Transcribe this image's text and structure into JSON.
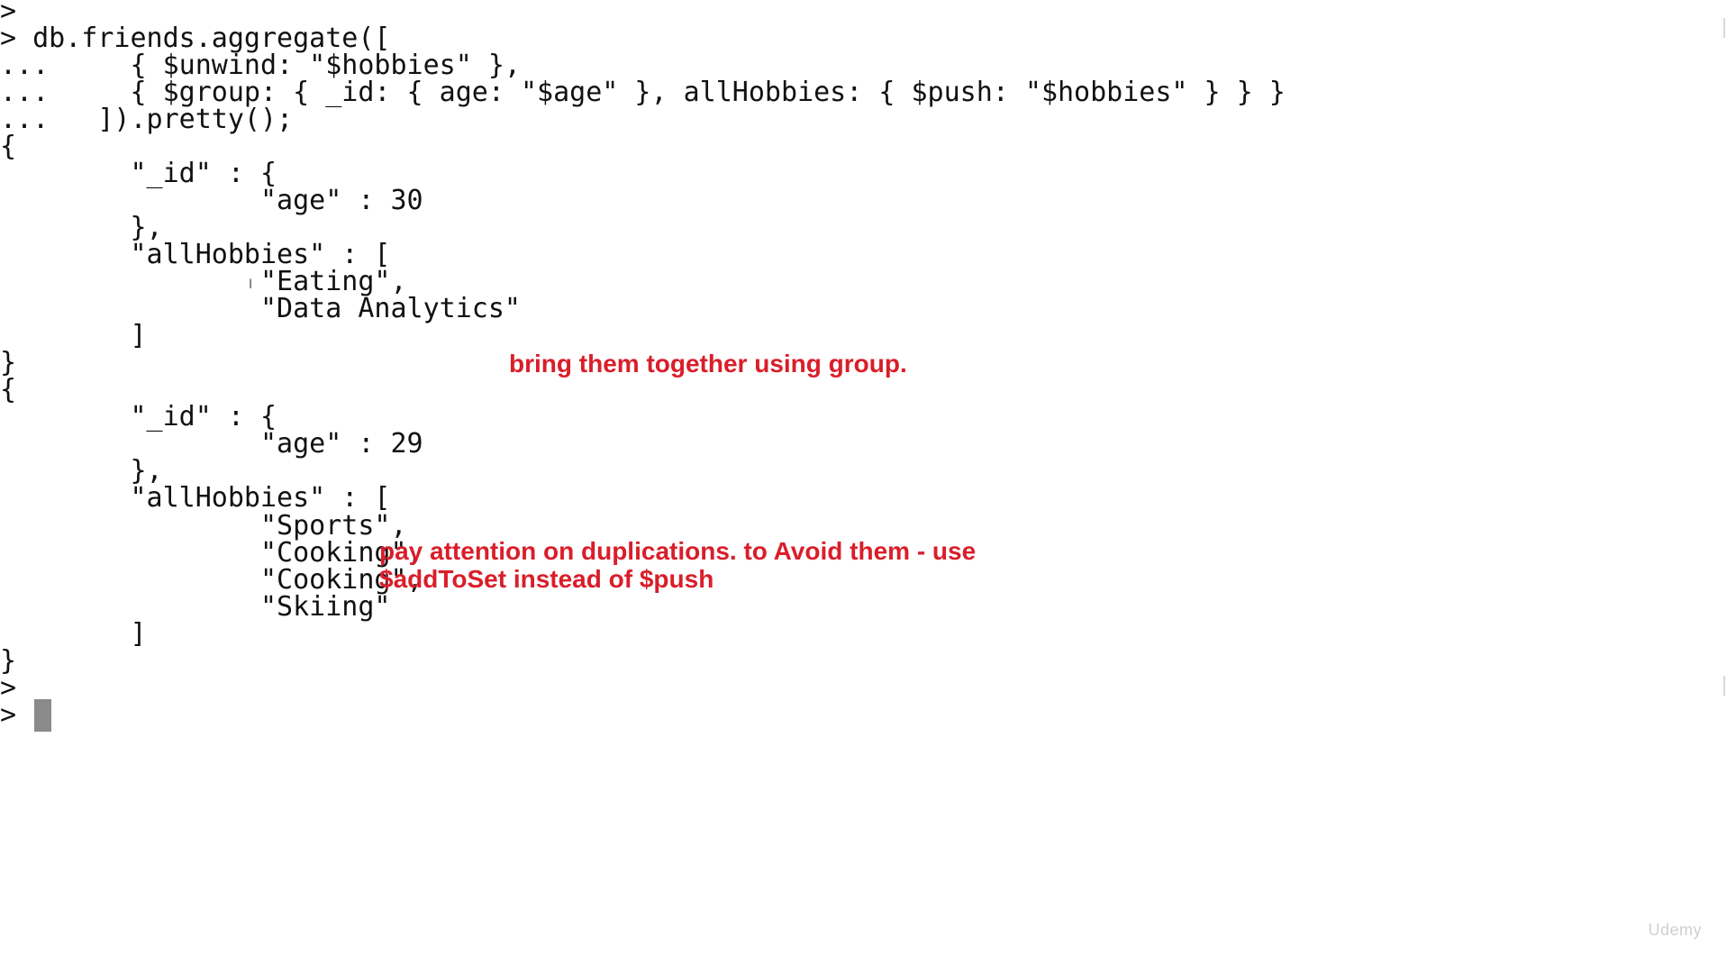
{
  "terminal": {
    "lines": [
      ">",
      "> db.friends.aggregate([",
      "...     { $unwind: \"$hobbies\" },",
      "...     { $group: { _id: { age: \"$age\" }, allHobbies: { $push: \"$hobbies\" } } }",
      "...   ]).pretty();",
      "{",
      "        \"_id\" : {",
      "                \"age\" : 30",
      "        },",
      "        \"allHobbies\" : [",
      "                \"Eating\",",
      "                \"Data Analytics\"",
      "        ]",
      "}",
      "{",
      "        \"_id\" : {",
      "                \"age\" : 29",
      "        },",
      "        \"allHobbies\" : [",
      "                \"Sports\",",
      "                \"Cooking\",",
      "                \"Cooking\",",
      "                \"Skiing\"",
      "        ]",
      "}",
      ">",
      "> "
    ]
  },
  "annotations": {
    "group_note": "bring them together using group.",
    "dup_note_line1": "pay attention on duplications. to Avoid them - use",
    "dup_note_line2": "$addToSet instead of $push",
    "color": "#d91e2a"
  },
  "watermark": "Udemy",
  "cursor_icon": "text-cursor-icon"
}
